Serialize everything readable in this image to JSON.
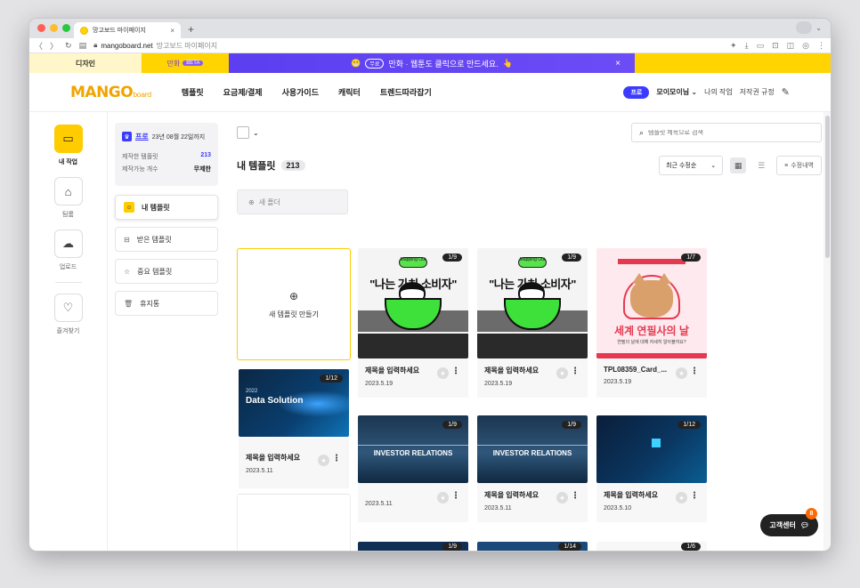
{
  "browser": {
    "tab_title": "망고보드 마이페이지",
    "tab_close": "×",
    "new_tab": "+",
    "url_domain": "mangoboard.net",
    "url_title": "망고보드 마이페이지",
    "nav": {
      "back": "〈",
      "forward": "〉",
      "reload": "↻"
    }
  },
  "promo": {
    "design_tab": "디자인",
    "comic_tab": "만화",
    "beta": "BETA",
    "banner_free": "무료",
    "banner_text": "만화 · 웹툰도 클릭으로 만드세요.",
    "close": "×"
  },
  "header": {
    "logo": "MANGO",
    "logo_small": "board",
    "nav": [
      "템플릿",
      "요금제/결제",
      "사용가이드",
      "캐릭터",
      "트렌드따라잡기"
    ],
    "pro": "프로",
    "user": "모이모이님",
    "links": [
      "나의 작업",
      "저작권 규정"
    ]
  },
  "rail": [
    {
      "label": "내 작업",
      "icon": "folder-icon"
    },
    {
      "label": "팀룸",
      "icon": "team-icon"
    },
    {
      "label": "업로드",
      "icon": "upload-icon"
    },
    {
      "label": "즐겨찾기",
      "icon": "heart-icon"
    }
  ],
  "plan": {
    "name": "프로",
    "until": "23년 08월 22일까지",
    "made_label": "제작한 템플릿",
    "made_value": "213",
    "limit_label": "제작가능 개수",
    "limit_value": "무제한"
  },
  "sidebar_menu": [
    {
      "label": "내 템플릿",
      "icon": "person-icon"
    },
    {
      "label": "받은 템플릿",
      "icon": "inbox-icon"
    },
    {
      "label": "중요 템플릿",
      "icon": "star-icon"
    },
    {
      "label": "휴지통",
      "icon": "trash-icon"
    }
  ],
  "toolbar": {
    "search_placeholder": "템플릿 제목으로 검색",
    "title": "내 템플릿",
    "count": "213",
    "sort": "최근 수정순",
    "history": "수정내역",
    "new_folder": "새 폴더"
  },
  "new_template": "새 템플릿 만들기",
  "cards": [
    {
      "pages": "1/9",
      "title": "제목을 입력하세요",
      "date": "2023.5.19",
      "thumb_text": "\"나는 가치 소비자\"",
      "thumb_tag": "Mapping Out"
    },
    {
      "pages": "1/9",
      "title": "제목을 입력하세요",
      "date": "2023.5.19",
      "thumb_text": "\"나는 가치 소비자\"",
      "thumb_tag": "Mapping Out"
    },
    {
      "pages": "1/7",
      "title": "TPL08359_Card_...",
      "date": "2023.5.19",
      "thumb_text": "세계 연필사의 날",
      "thumb_sub": "연필의 날에 대해 자세히 알아볼까요?"
    },
    {
      "pages": "1/12",
      "title": "제목을 입력하세요",
      "date": "2023.5.11",
      "thumb_l1": "2022",
      "thumb_l2": "Data Solution"
    },
    {
      "pages": "1/9",
      "title": "",
      "date": "2023.5.11",
      "thumb_text": "INVESTOR RELATIONS"
    },
    {
      "pages": "1/9",
      "title": "제목을 입력하세요",
      "date": "2023.5.11",
      "thumb_text": "INVESTOR RELATIONS"
    },
    {
      "pages": "1/12",
      "title": "제목을 입력하세요",
      "date": "2023.5.10"
    },
    {
      "pages": "1/9"
    },
    {
      "pages": "1/14"
    },
    {
      "pages": "1/6"
    }
  ],
  "customer_center": "고객센터",
  "cs_badge": "8"
}
